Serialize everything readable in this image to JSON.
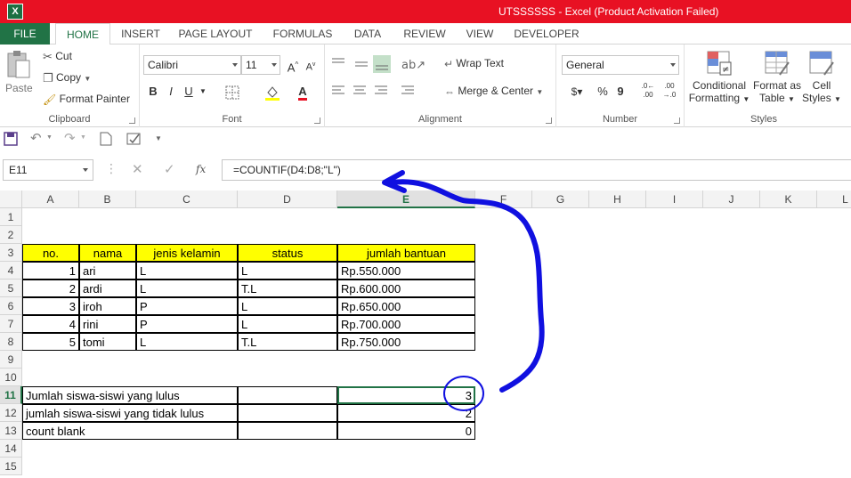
{
  "window": {
    "title": "UTSSSSSS -  Excel (Product Activation Failed)",
    "logo_text": "X"
  },
  "tabs": [
    "FILE",
    "HOME",
    "INSERT",
    "PAGE LAYOUT",
    "FORMULAS",
    "DATA",
    "REVIEW",
    "VIEW",
    "DEVELOPER"
  ],
  "ribbon": {
    "clipboard": {
      "paste": "Paste",
      "cut": "Cut",
      "copy": "Copy",
      "format_painter": "Format Painter",
      "label": "Clipboard"
    },
    "font": {
      "name": "Calibri",
      "size": "11",
      "bold": "B",
      "italic": "I",
      "underline": "U",
      "grow": "A",
      "shrink": "A",
      "label": "Font"
    },
    "alignment": {
      "wrap_text": "Wrap Text",
      "merge_center": "Merge & Center",
      "label": "Alignment"
    },
    "number": {
      "format": "General",
      "percent": "%",
      "comma": "9",
      "inc_decimal": ".00 ←.0",
      "dec_decimal": ".00 →.0",
      "label": "Number"
    },
    "styles": {
      "conditional_formatting_1": "Conditional",
      "conditional_formatting_2": "Formatting",
      "format_as_table_1": "Format as",
      "format_as_table_2": "Table",
      "cell_styles_1": "Cell",
      "cell_styles_2": "Styles",
      "label": "Styles"
    }
  },
  "formula_bar": {
    "name_box": "E11",
    "fx": "fx",
    "formula": "=COUNTIF(D4:D8;\"L\")"
  },
  "columns": [
    "A",
    "B",
    "C",
    "D",
    "E",
    "F",
    "G",
    "H",
    "I",
    "J",
    "K",
    "L"
  ],
  "rows": [
    "1",
    "2",
    "3",
    "4",
    "5",
    "6",
    "7",
    "8",
    "9",
    "10",
    "11",
    "12",
    "13",
    "14",
    "15"
  ],
  "table": {
    "headers": [
      "no.",
      "nama",
      "jenis kelamin",
      "status",
      "jumlah bantuan"
    ],
    "rows": [
      [
        "1",
        "ari",
        "L",
        "L",
        "Rp.550.000"
      ],
      [
        "2",
        "ardi",
        "L",
        "T.L",
        "Rp.600.000"
      ],
      [
        "3",
        "iroh",
        "P",
        "L",
        "Rp.650.000"
      ],
      [
        "4",
        "rini",
        "P",
        "L",
        "Rp.700.000"
      ],
      [
        "5",
        "tomi",
        "L",
        "T.L",
        "Rp.750.000"
      ]
    ]
  },
  "summary": [
    {
      "label": "Jumlah siswa-siswi yang lulus",
      "value": "3"
    },
    {
      "label": "jumlah siswa-siswi yang tidak lulus",
      "value": "2"
    },
    {
      "label": "count blank",
      "value": "0"
    }
  ],
  "colors": {
    "title_bar": "#e81123",
    "excel_green": "#217346",
    "header_fill": "#ffff00",
    "annotation": "#1010e0"
  }
}
